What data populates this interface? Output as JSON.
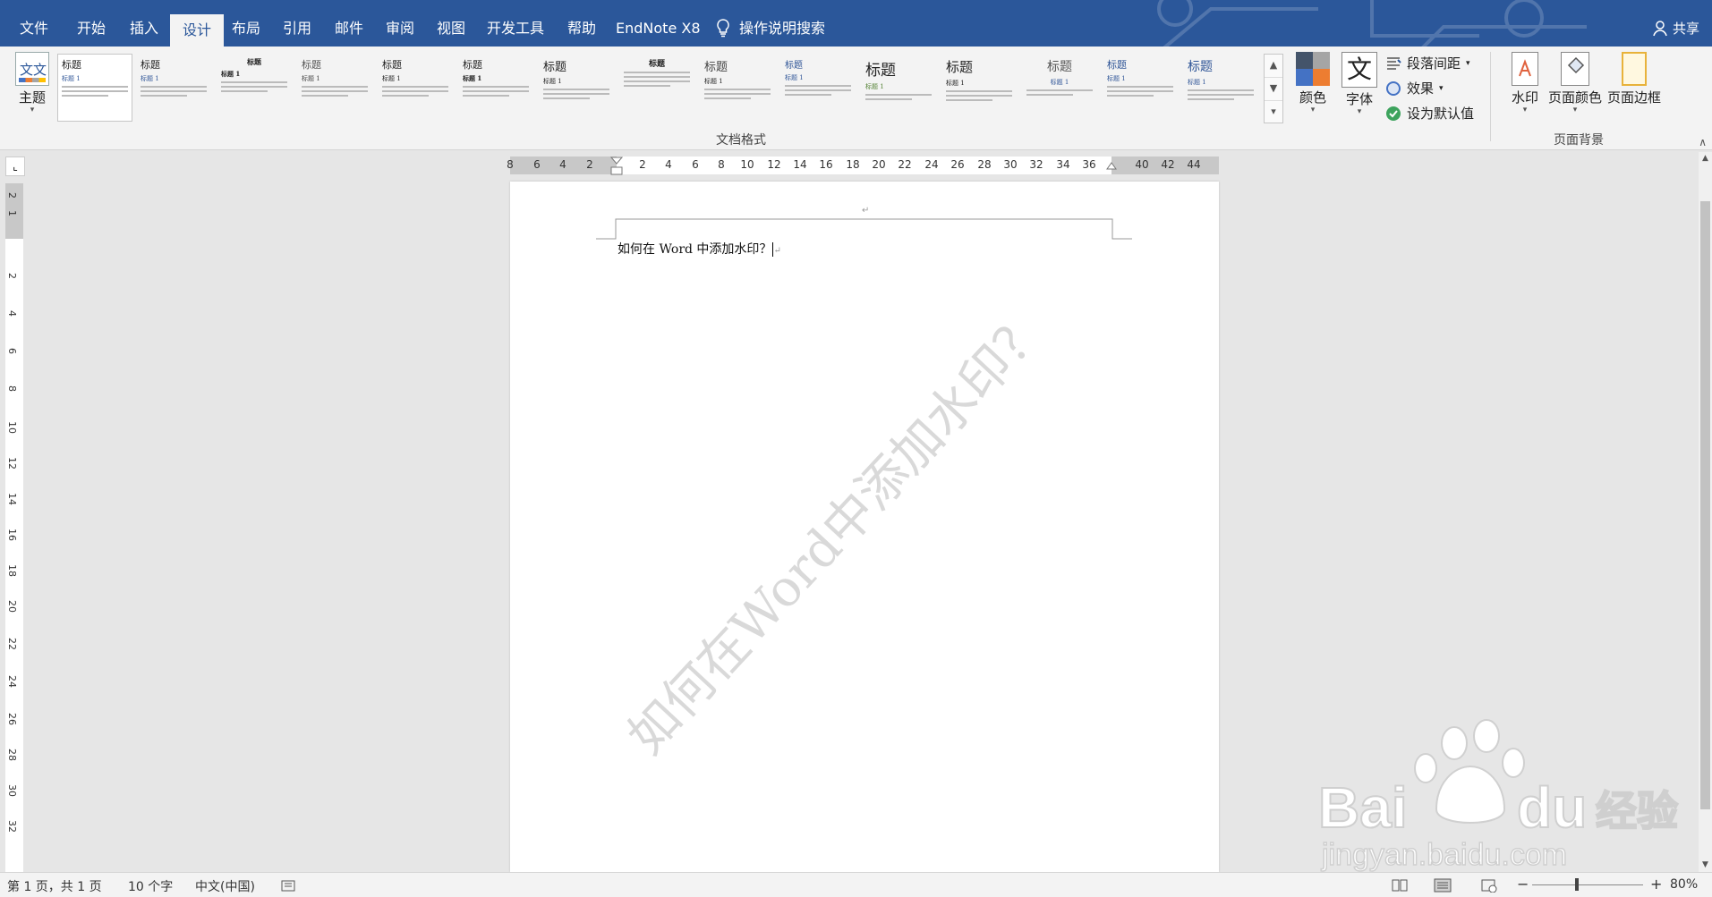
{
  "tabs": [
    {
      "label": "文件",
      "active": false
    },
    {
      "label": "开始",
      "active": false
    },
    {
      "label": "插入",
      "active": false
    },
    {
      "label": "设计",
      "active": true
    },
    {
      "label": "布局",
      "active": false
    },
    {
      "label": "引用",
      "active": false
    },
    {
      "label": "邮件",
      "active": false
    },
    {
      "label": "审阅",
      "active": false
    },
    {
      "label": "视图",
      "active": false
    },
    {
      "label": "开发工具",
      "active": false
    },
    {
      "label": "帮助",
      "active": false
    },
    {
      "label": "EndNote X8",
      "active": false
    }
  ],
  "tell_me": "操作说明搜索",
  "share": "共享",
  "ribbon": {
    "theme": "主题",
    "theme_icon_text": "文文",
    "style_heading": "标题",
    "style_heading1": "标题 1",
    "group_doc_format": "文档格式",
    "colors": "颜色",
    "fonts": "字体",
    "fonts_icon_text": "文",
    "paragraph_spacing": "段落间距",
    "effects": "效果",
    "set_default": "设为默认值",
    "watermark": "水印",
    "page_color": "页面颜色",
    "page_border": "页面边框",
    "group_page_bg": "页面背景"
  },
  "ruler": {
    "left_ticks": [
      "8",
      "6",
      "4",
      "2"
    ],
    "right_ticks": [
      "2",
      "4",
      "6",
      "8",
      "10",
      "12",
      "14",
      "16",
      "18",
      "20",
      "22",
      "24",
      "26",
      "28",
      "30",
      "32",
      "34",
      "36",
      "40",
      "42",
      "44"
    ],
    "vertical_ticks": [
      "2",
      "1",
      "2",
      "4",
      "6",
      "8",
      "10",
      "12",
      "14",
      "16",
      "18",
      "20",
      "22",
      "24",
      "26",
      "28",
      "30",
      "32"
    ]
  },
  "document": {
    "text": "如何在 Word 中添加水印？",
    "watermark_text": "如何在Word中添加水印？",
    "paragraph_mark": "↵"
  },
  "status": {
    "page": "第 1 页，共 1 页",
    "words": "10 个字",
    "language": "中文(中国)",
    "zoom": "80%"
  },
  "branding": {
    "logo_text": "Bai  du 经验",
    "url": "jingyan.baidu.com"
  },
  "colors": {
    "accent": "#2b579a",
    "ribbon_bg": "#f3f3f3"
  }
}
